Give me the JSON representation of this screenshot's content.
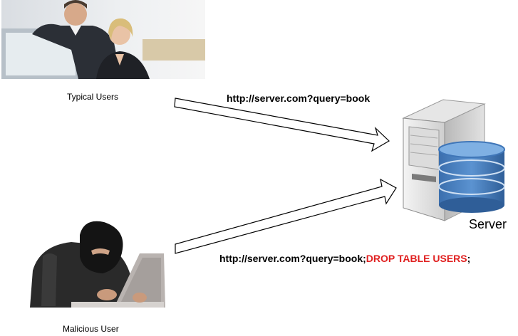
{
  "labels": {
    "typical_users": "Typical Users",
    "malicious_user": "Malicious User",
    "server": "Server"
  },
  "requests": {
    "normal_url": "http://server.com?query=book",
    "malicious_url_prefix": "http://server.com?query=book;",
    "malicious_injection": "DROP TABLE USERS",
    "malicious_suffix": ";"
  },
  "colors": {
    "injection": "#e02020",
    "arrow_stroke": "#000000",
    "arrow_fill": "#ffffff",
    "db_blue": "#3f76b8"
  },
  "icons": {
    "typical_users": "office-users-photo",
    "malicious_user": "hooded-hacker-photo",
    "server": "server-with-database-icon"
  }
}
